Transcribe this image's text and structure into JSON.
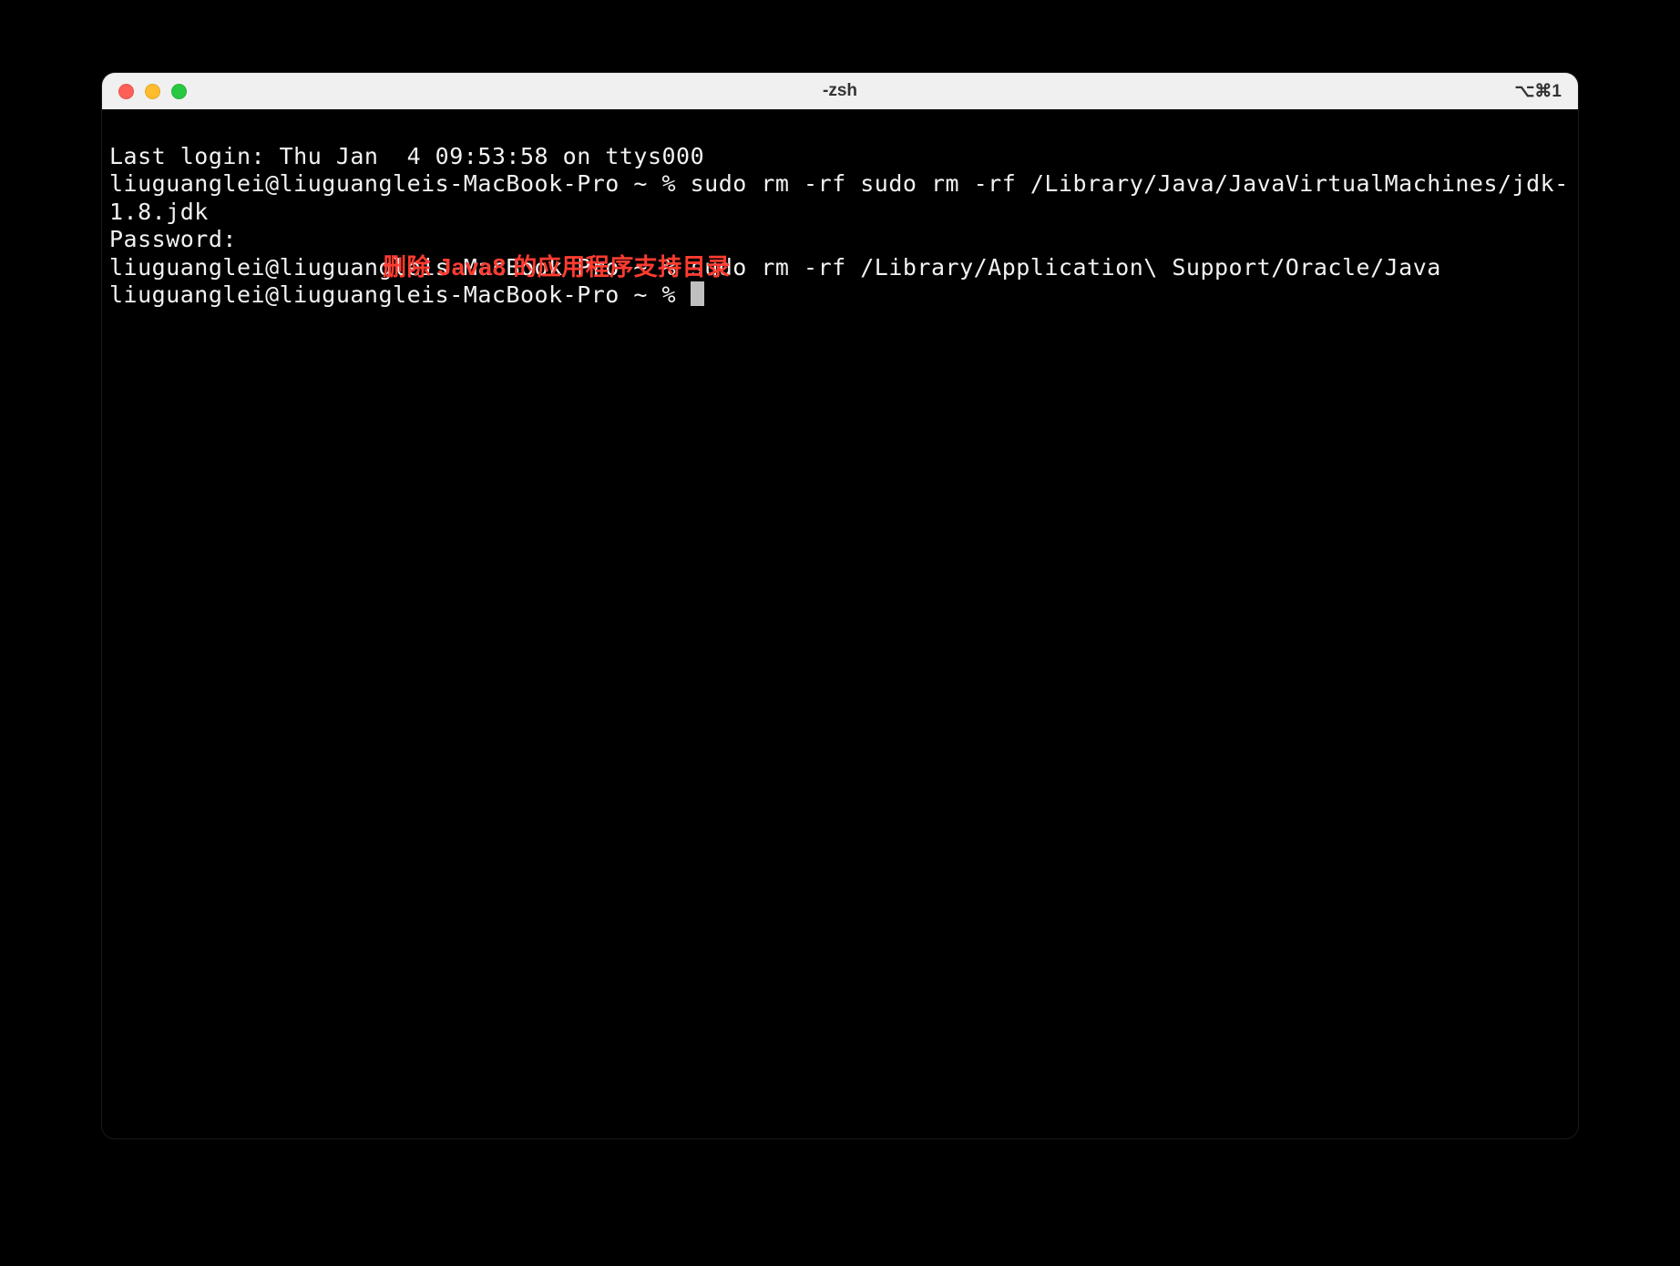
{
  "window": {
    "title": "-zsh",
    "shortcut": "⌥⌘1"
  },
  "terminal": {
    "line1": "Last login: Thu Jan  4 09:53:58 on ttys000",
    "line2": "liuguanglei@liuguangleis-MacBook-Pro ~ % sudo rm -rf sudo rm -rf /Library/Java/JavaVirtualMachines/jdk-1.8.jdk",
    "line3": "Password:",
    "line4": "liuguanglei@liuguangleis-MacBook-Pro ~ % sudo rm -rf /Library/Application\\ Support/Oracle/Java",
    "line5_prompt": "liuguanglei@liuguangleis-MacBook-Pro ~ % "
  },
  "annotation": {
    "text": "删除 Java8 的应用程序支持目录"
  }
}
